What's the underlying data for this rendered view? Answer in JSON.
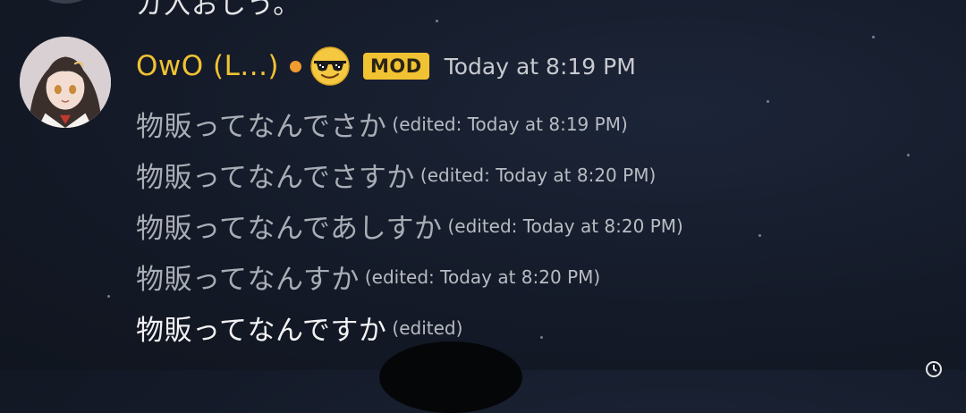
{
  "previous_message": {
    "text": "ガ入おしう。"
  },
  "header": {
    "username": "OwO (L...)",
    "status": "idle",
    "status_color": "#f29b2f",
    "emoji_icon": "sunglasses-emoji-icon",
    "badge": "MOD",
    "badge_color": "#f1c232",
    "timestamp": "Today at 8:19 PM"
  },
  "messages": [
    {
      "text": "物販ってなんでさか",
      "edited": "(edited: Today at 8:19 PM)"
    },
    {
      "text": "物販ってなんでさすか",
      "edited": "(edited: Today at 8:20 PM)"
    },
    {
      "text": "物販ってなんであしすか",
      "edited": "(edited: Today at 8:20 PM)"
    },
    {
      "text": "物販ってなんすか",
      "edited": "(edited: Today at 8:20 PM)"
    },
    {
      "text": "物販ってなんですか",
      "edited": "(edited)"
    }
  ],
  "colors": {
    "username": "#f1c232",
    "background": "#141a28",
    "history_text": "#a9adb5",
    "current_text": "#f2f2f4"
  }
}
